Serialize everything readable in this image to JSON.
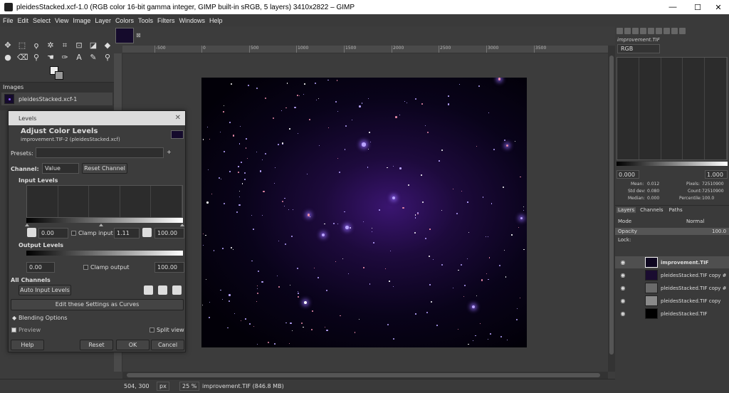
{
  "window": {
    "title": "pleidesStacked.xcf-1.0 (RGB color 16-bit gamma integer, GIMP built-in sRGB, 5 layers) 3410x2822 – GIMP",
    "minimize": "—",
    "maximize": "☐",
    "close": "✕"
  },
  "menu": [
    "File",
    "Edit",
    "Select",
    "View",
    "Image",
    "Layer",
    "Colors",
    "Tools",
    "Filters",
    "Windows",
    "Help"
  ],
  "images_panel": {
    "tab": "Images",
    "item": "pleidesStacked.xcf-1"
  },
  "ruler": {
    "ticks": [
      "-500",
      "0",
      "500",
      "1000",
      "1500",
      "2000",
      "2500",
      "3000",
      "3500"
    ]
  },
  "canvas": {
    "tab_close": "⊠"
  },
  "status": {
    "coords": "504, 300",
    "unit": "px",
    "zoom": "25 %",
    "info": "improvement.TIF (846.8 MB)"
  },
  "levels": {
    "window_title": "Levels",
    "heading": "Adjust Color Levels",
    "subtitle": "improvement.TIF-2 (pleidesStacked.xcf)",
    "presets_label": "Presets:",
    "channel_label": "Channel:",
    "channel_value": "Value",
    "reset_channel": "Reset Channel",
    "input_levels": "Input Levels",
    "input_low": "0.00",
    "clamp_input": "Clamp input",
    "gamma": "1.11",
    "input_high": "100.00",
    "output_levels": "Output Levels",
    "output_low": "0.00",
    "clamp_output": "Clamp output",
    "output_high": "100.00",
    "all_channels": "All Channels",
    "auto_input": "Auto Input Levels",
    "edit_curves": "Edit these Settings as Curves",
    "blending": "Blending Options",
    "preview": "Preview",
    "split_view": "Split view",
    "help": "Help",
    "reset": "Reset",
    "ok": "OK",
    "cancel": "Cancel"
  },
  "histogram": {
    "title": "improvement.TIF",
    "channel": "RGB",
    "low": "0.000",
    "high": "1.000",
    "mean_label": "Mean:",
    "mean": "0.012",
    "stddev_label": "Std dev:",
    "stddev": "0.080",
    "median_label": "Median:",
    "median": "0.000",
    "pixels_label": "Pixels:",
    "pixels": "72510900",
    "count_label": "Count:",
    "count": "72510900",
    "percentile_label": "Percentile:",
    "percentile": "100.0"
  },
  "layers_panel": {
    "tabs": [
      "Layers",
      "Channels",
      "Paths"
    ],
    "mode_label": "Mode",
    "mode_value": "Normal",
    "opacity_label": "Opacity",
    "opacity_value": "100.0",
    "lock_label": "Lock:",
    "layers": [
      "improvement.TIF",
      "pleidesStacked.TIF copy #",
      "pleidesStacked.TIF copy #",
      "pleidesStacked.TIF copy",
      "pleidesStacked.TIF"
    ]
  }
}
